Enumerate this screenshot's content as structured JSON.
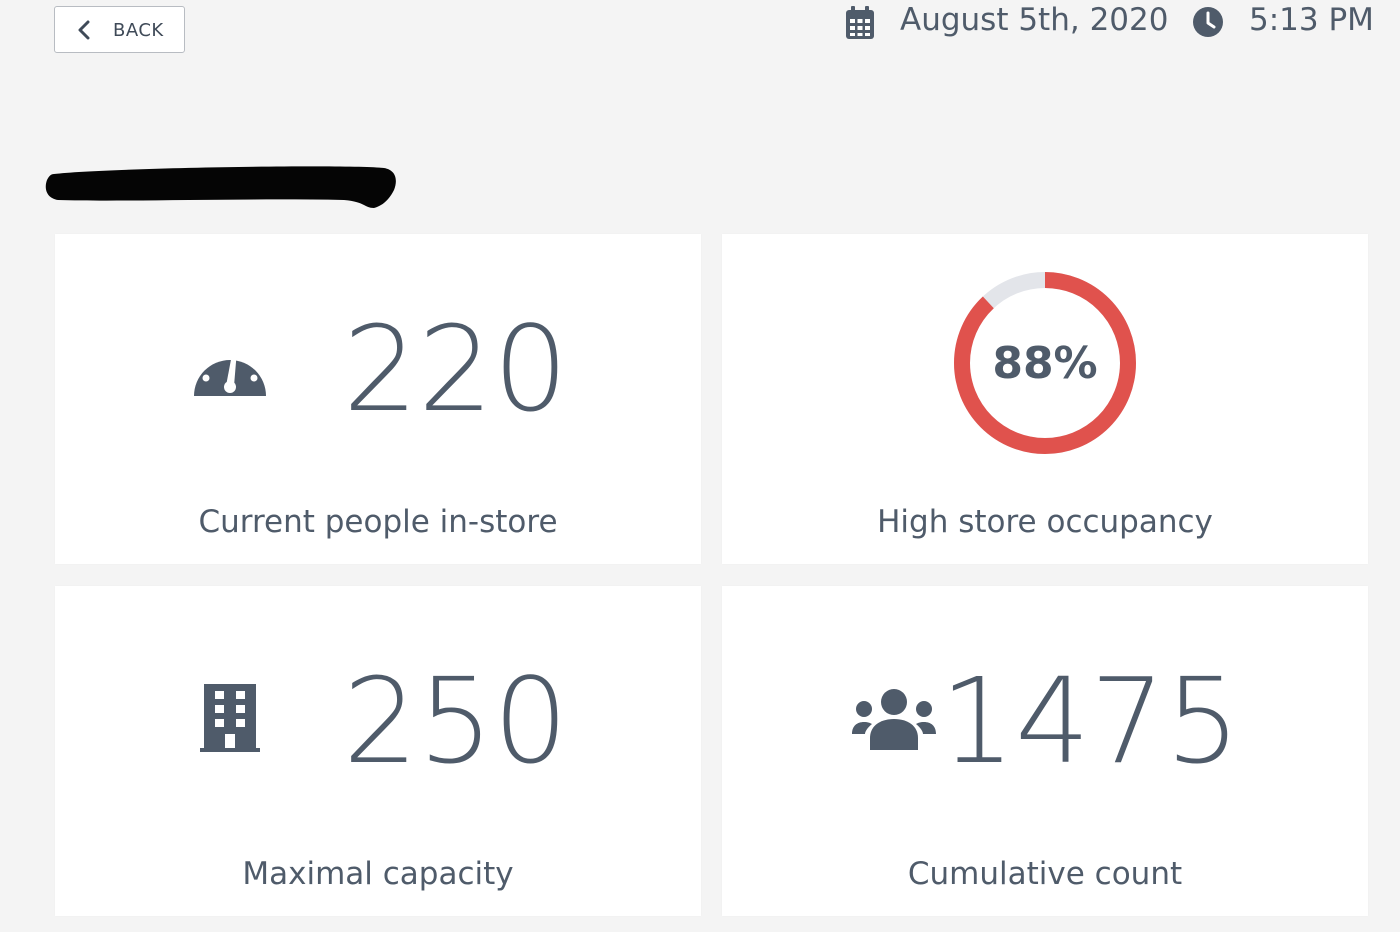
{
  "header": {
    "back_label": "BACK",
    "date": "August 5th, 2020",
    "time": "5:13 PM"
  },
  "cards": {
    "current_people": {
      "value": "220",
      "label": "Current people in-store"
    },
    "occupancy": {
      "percent_text": "88%",
      "percent_value": 88,
      "label": "High store occupancy"
    },
    "max_capacity": {
      "value": "250",
      "label": "Maximal capacity"
    },
    "cumulative": {
      "value": "1475",
      "label": "Cumulative count"
    }
  },
  "colors": {
    "text": "#4f5b6a",
    "icon": "#4f5b6a",
    "donut_fill": "#e0524d",
    "donut_track": "#e3e5ea",
    "card_bg": "#ffffff",
    "page_bg": "#f4f4f4"
  },
  "icons": {
    "back": "chevron-left-icon",
    "date": "calendar-icon",
    "time": "clock-icon",
    "current_people": "speedometer-icon",
    "max_capacity": "building-icon",
    "cumulative": "users-icon"
  }
}
